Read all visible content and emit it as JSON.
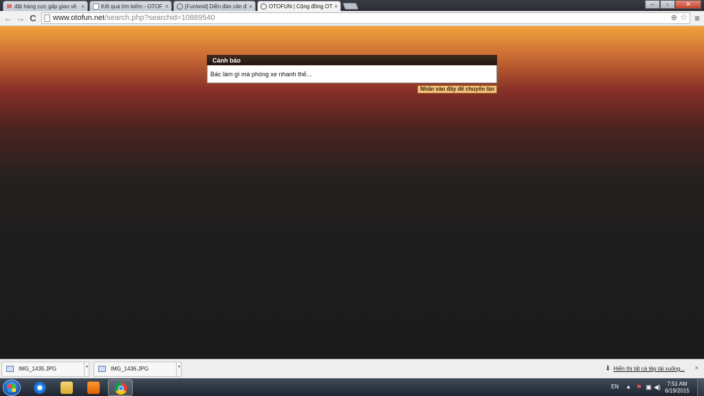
{
  "browser": {
    "tabs": [
      {
        "label": "đặt hàng cực gấp giao về",
        "icon": "gmail-icon",
        "active": false
      },
      {
        "label": "Kết quả tìm kiếm - OTOF",
        "icon": "page-icon",
        "active": false
      },
      {
        "label": "[Funland] Diễn đàn cân đ",
        "icon": "otofun-icon",
        "active": false
      },
      {
        "label": "OTOFUN | Cộng đồng OT",
        "icon": "otofun-icon",
        "active": true
      }
    ],
    "close_glyph": "×",
    "window_buttons": {
      "minimize": "–",
      "maximize": "▫",
      "close": "✕"
    },
    "nav": {
      "back": "←",
      "forward": "→",
      "reload": "C"
    },
    "url": {
      "domain": "www.otofun.net",
      "path": "/search.php?searchid=10889540"
    },
    "menu_glyph": "≡",
    "zoom_glyph": "⊕",
    "star_glyph": "☆"
  },
  "page": {
    "dialog_title": "Cảnh báo",
    "dialog_message": "Bác làm gì mà phóng xe nhanh thế...",
    "redirect_button": "Nhấn vào đây để chuyển làn"
  },
  "downloads": {
    "items": [
      {
        "filename": "IMG_1435.JPG"
      },
      {
        "filename": "IMG_1436.JPG"
      }
    ],
    "show_all": "Hiển thị tất cả tệp tải xuống...",
    "close_glyph": "×",
    "download_glyph": "⬇",
    "caret_glyph": "▾"
  },
  "taskbar": {
    "language": "EN",
    "tray_arrow": "▲",
    "tray_glyphs": {
      "flag": "⚑",
      "network": "▣",
      "volume": "◀)"
    },
    "time": "7:51 AM",
    "date": "6/19/2015"
  },
  "colors": {
    "page_top": "#f0a23b",
    "page_mid": "#852e27",
    "page_bottom": "#1b1b1b",
    "dialog_header": "#241711",
    "redirect_button_bg": "#f2c27b"
  }
}
